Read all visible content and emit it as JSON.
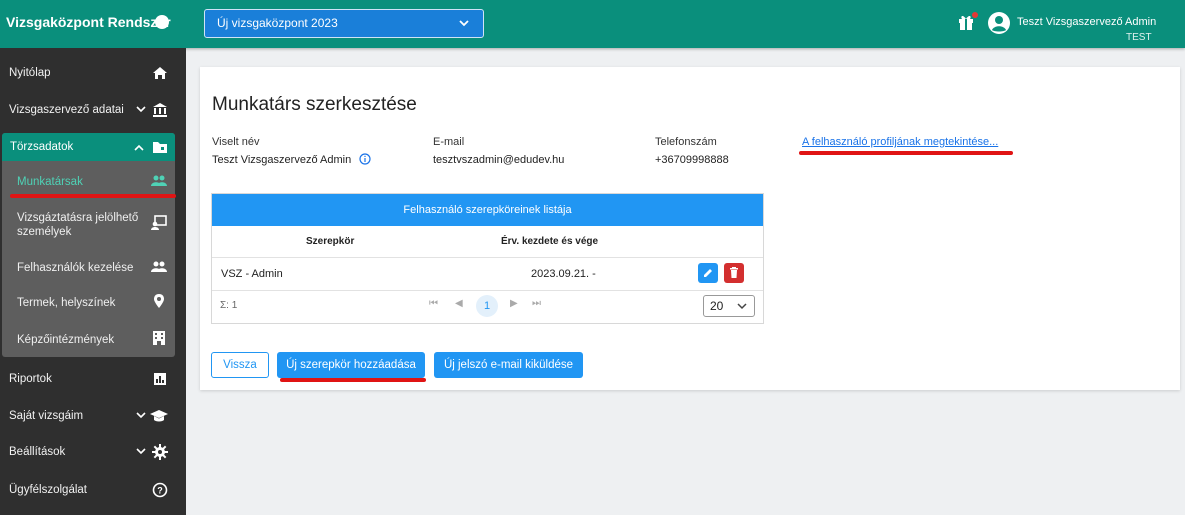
{
  "topbar": {
    "app_title": "Vizsgaközpont Rendszer",
    "center_select": "Új vizsgaközpont 2023",
    "user_name": "Teszt Vizsgaszervező Admin",
    "environment": "TEST",
    "icons": [
      "gift-icon",
      "account-circle-icon"
    ]
  },
  "sidebar": {
    "items": [
      {
        "label": "Nyitólap",
        "icon": "home-icon"
      },
      {
        "label": "Vizsgaszervező adatai",
        "icon": "bank-icon"
      },
      {
        "label": "Törzsadatok",
        "icon": "folder-icon"
      },
      {
        "label": "Riportok",
        "icon": "chart-icon"
      },
      {
        "label": "Saját vizsgáim",
        "icon": "graduation-cap-icon"
      },
      {
        "label": "Beállítások",
        "icon": "gear-icon"
      },
      {
        "label": "Ügyfélszolgálat",
        "icon": "help-icon"
      }
    ],
    "sub_items": [
      {
        "label": "Munkatársak",
        "icon": "people-icon",
        "active": true
      },
      {
        "label_line1": "Vizsgáztatásra jelölhető",
        "label_line2": "személyek",
        "icon": "presenter-icon"
      },
      {
        "label": "Felhasználók kezelése",
        "icon": "people-icon"
      },
      {
        "label": "Termek, helyszínek",
        "icon": "location-icon"
      },
      {
        "label": "Képzőintézmények",
        "icon": "building-icon"
      }
    ]
  },
  "main": {
    "title": "Munkatárs szerkesztése",
    "fields": [
      {
        "label": "Viselt név",
        "value": "Teszt Vizsgaszervező Admin"
      },
      {
        "label": "E-mail",
        "value": "tesztvszadmin@edudev.hu"
      },
      {
        "label": "Telefonszám",
        "value": "+36709998888"
      }
    ],
    "profile_link": "A felhasználó profiljának megtekintése...",
    "role_table": {
      "title": "Felhasználó szerepköreinek listája",
      "columns": [
        "Szerepkör",
        "Érv. kezdete és vége"
      ],
      "rows": [
        {
          "role": "VSZ - Admin",
          "validity": "2023.09.21. -"
        }
      ],
      "sum": "Σ: 1",
      "page": "1",
      "per_page": "20"
    },
    "buttons": {
      "back": "Vissza",
      "add_role": "Új szerepkör hozzáadása",
      "send_password": "Új jelszó e-mail kiküldése"
    }
  },
  "colors": {
    "brand": "#0a8f7c",
    "accent": "#2196f3",
    "danger": "#d32f2f",
    "highlight_underline": "#e01414"
  }
}
